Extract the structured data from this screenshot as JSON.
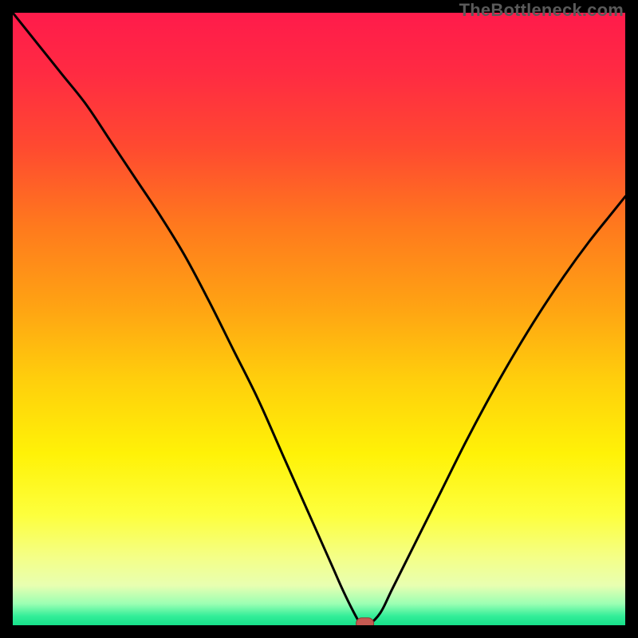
{
  "watermark": {
    "text": "TheBottleneck.com"
  },
  "colors": {
    "gradient_stops": [
      {
        "offset": 0.0,
        "color": "#ff1b4b"
      },
      {
        "offset": 0.1,
        "color": "#ff2b42"
      },
      {
        "offset": 0.22,
        "color": "#ff4a30"
      },
      {
        "offset": 0.35,
        "color": "#ff7a1d"
      },
      {
        "offset": 0.48,
        "color": "#ffa313"
      },
      {
        "offset": 0.6,
        "color": "#ffcf0c"
      },
      {
        "offset": 0.72,
        "color": "#fff207"
      },
      {
        "offset": 0.82,
        "color": "#fdff3d"
      },
      {
        "offset": 0.89,
        "color": "#f4ff88"
      },
      {
        "offset": 0.935,
        "color": "#e8ffb1"
      },
      {
        "offset": 0.965,
        "color": "#9bffb3"
      },
      {
        "offset": 0.985,
        "color": "#33ee99"
      },
      {
        "offset": 1.0,
        "color": "#17e08a"
      }
    ],
    "curve": "#000000",
    "marker_fill": "#c65a52",
    "marker_stroke": "#8f3c36",
    "frame": "#000000"
  },
  "chart_data": {
    "type": "line",
    "title": "",
    "xlabel": "",
    "ylabel": "",
    "xlim": [
      0,
      100
    ],
    "ylim": [
      0,
      100
    ],
    "grid": false,
    "legend": "none",
    "series": [
      {
        "name": "bottleneck-curve",
        "x": [
          0,
          4,
          8,
          12,
          16,
          20,
          24,
          28,
          32,
          36,
          40,
          44,
          48,
          52,
          54,
          56,
          57,
          58,
          60,
          62,
          66,
          70,
          74,
          78,
          82,
          86,
          90,
          94,
          98,
          100
        ],
        "y": [
          100,
          95,
          90,
          85,
          79,
          73,
          67,
          60.5,
          53,
          45,
          37,
          28,
          19,
          10,
          5.5,
          1.5,
          0,
          0,
          2,
          6,
          14,
          22,
          30,
          37.5,
          44.5,
          51,
          57,
          62.5,
          67.5,
          70
        ]
      }
    ],
    "annotations": [
      {
        "name": "optimal-marker",
        "x": 57.5,
        "y": 0.3,
        "shape": "pill"
      }
    ]
  }
}
